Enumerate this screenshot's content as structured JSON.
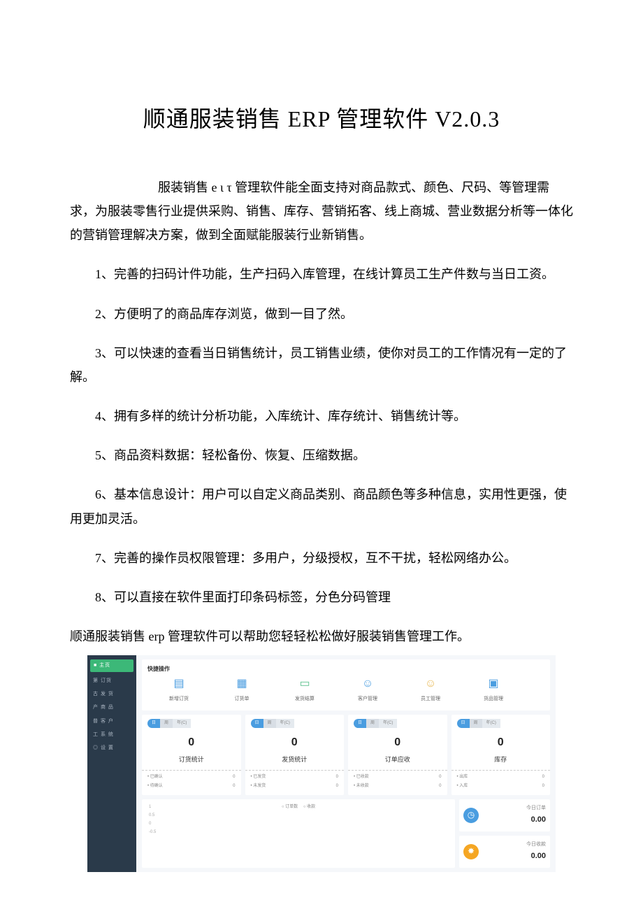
{
  "title": "顺通服装销售 ERP 管理软件 V2.0.3",
  "intro": "服装销售 e ɩ τ 管理软件能全面支持对商品款式、颜色、尺码、等管理需求，为服装零售行业提供采购、销售、库存、营销拓客、线上商城、营业数据分析等一体化的营销管理解决方案，做到全面赋能服装行业新销售。",
  "points": [
    "1、完善的扫码计件功能，生产扫码入库管理，在线计算员工生产件数与当日工资。",
    "2、方便明了的商品库存浏览，做到一目了然。",
    "3、可以快速的查看当日销售统计，员工销售业绩，使你对员工的工作情况有一定的了解。",
    "4、拥有多样的统计分析功能，入库统计、库存统计、销售统计等。",
    "5、商品资料数据：轻松备份、恢复、压缩数据。",
    "6、基本信息设计：用户可以自定义商品类别、商品颜色等多种信息，实用性更强，使用更加灵活。",
    "7、完善的操作员权限管理：多用户，分级授权，互不干扰，轻松网络办公。",
    "8、可以直接在软件里面打印条码标签，分色分码管理"
  ],
  "closing": "顺通服装销售 erp 管理软件可以帮助您轻轻松松做好服装销售管理工作。",
  "figure": {
    "sidebar": {
      "top_label": "■ 主页",
      "items": [
        "第 订货",
        "古 发 货",
        "产 商 品",
        "普 客 户",
        "工 系 统",
        "◎ 设 置"
      ]
    },
    "quick": {
      "section_title": "快捷操作",
      "items": [
        {
          "label": "新增订货",
          "color": "qi-blue",
          "glyph": "▤"
        },
        {
          "label": "订货单",
          "color": "qi-blue",
          "glyph": "▦"
        },
        {
          "label": "发货结算",
          "color": "qi-green",
          "glyph": "▭"
        },
        {
          "label": "客户管理",
          "color": "qi-blue",
          "glyph": "☺"
        },
        {
          "label": "员工管理",
          "color": "qi-yellow",
          "glyph": "☺"
        },
        {
          "label": "货品管理",
          "color": "qi-blue",
          "glyph": "▣"
        }
      ]
    },
    "stats": [
      {
        "tabs": [
          "日",
          "周",
          "年(C)"
        ],
        "num": "0",
        "title": "订货统计",
        "sub": [
          [
            "已确认",
            "0"
          ],
          [
            "待确认",
            "0"
          ]
        ]
      },
      {
        "tabs": [
          "日",
          "周",
          "年(C)"
        ],
        "num": "0",
        "title": "发货统计",
        "sub": [
          [
            "已发货",
            "0"
          ],
          [
            "未发货",
            "0"
          ]
        ]
      },
      {
        "tabs": [
          "日",
          "周",
          "年(C)"
        ],
        "num": "0",
        "title": "订单应收",
        "sub": [
          [
            "已收款",
            "0"
          ],
          [
            "未收款",
            "0"
          ]
        ]
      },
      {
        "tabs": [
          "日",
          "周",
          "年(C)"
        ],
        "num": "0",
        "title": "库存",
        "sub": [
          [
            "出库",
            "0"
          ],
          [
            "入库",
            "0"
          ]
        ]
      }
    ],
    "chart": {
      "y": [
        "1",
        "0.5",
        "0",
        "-0.5"
      ],
      "legend": [
        "○ 订单数",
        "○ 收款"
      ]
    },
    "mini": [
      {
        "label": "今日订单",
        "value": "0.00",
        "cls": "mi-blue",
        "glyph": "◷"
      },
      {
        "label": "今日收款",
        "value": "0.00",
        "cls": "mi-orange",
        "glyph": "✸"
      }
    ]
  },
  "chart_data": {
    "type": "line",
    "title": "",
    "xlabel": "",
    "ylabel": "",
    "ylim": [
      -0.5,
      1
    ],
    "series": [
      {
        "name": "订单数",
        "values": []
      },
      {
        "name": "收款",
        "values": []
      }
    ],
    "x": []
  }
}
